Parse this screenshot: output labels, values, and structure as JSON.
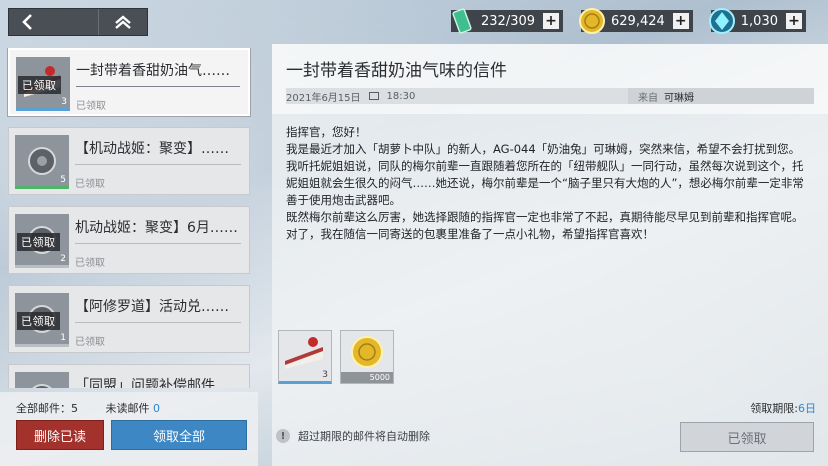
{
  "nav": {
    "back_icon": "chevron-left-icon",
    "home_icon": "chevron-up-icon"
  },
  "resources": [
    {
      "icon": "battery-icon",
      "value": "232/309"
    },
    {
      "icon": "gold-coin-icon",
      "value": "629,424"
    },
    {
      "icon": "gem-icon",
      "value": "1,030"
    }
  ],
  "mails": [
    {
      "title": "一封带着香甜奶油气……",
      "status": "已领取",
      "badge": "已领取",
      "count": "3",
      "selected": true,
      "thumb": "cake-icon"
    },
    {
      "title": "【机动战姬：聚变】……",
      "status": "已领取",
      "badge": "",
      "count": "5",
      "selected": false,
      "thumb": "part-icon"
    },
    {
      "title": "机动战姬：聚变】6月……",
      "status": "已领取",
      "badge": "已领取",
      "count": "2",
      "selected": false,
      "thumb": "part-icon"
    },
    {
      "title": "【阿修罗道】活动兑……",
      "status": "已领取",
      "badge": "已领取",
      "count": "1",
      "selected": false,
      "thumb": "part-icon"
    },
    {
      "title": "「同盟」问题补偿邮件",
      "status": "",
      "badge": "",
      "count": "",
      "selected": false,
      "thumb": "part-icon"
    }
  ],
  "footer_left": {
    "total_label": "全部邮件：",
    "total_value": "5",
    "unread_label": "未读邮件",
    "unread_value": "0",
    "delete_read": "删除已读",
    "claim_all": "领取全部"
  },
  "detail": {
    "title": "一封带着香甜奶油气味的信件",
    "date": "2021年6月15日",
    "time": "18:30",
    "from_label": "来自",
    "from": "可琳姆",
    "body": [
      "指挥官，您好！",
      "我是最近才加入「胡萝卜中队」的新人，AG-044「奶油兔」可琳姆，突然来信，希望不会打扰到您。",
      "我听托妮姐姐说，同队的梅尔前辈一直跟随着您所在的「纽带舰队」一同行动，虽然每次说到这个，托妮姐姐就会生很久的闷气……她还说，梅尔前辈是一个“脑子里只有大炮的人”，想必梅尔前辈一定非常善于使用炮击武器吧。",
      "既然梅尔前辈这么厉害，她选择跟随的指挥官一定也非常了不起，真期待能尽早见到前辈和指挥官呢。",
      "对了，我在随信一同寄送的包裹里准备了一点小礼物，希望指挥官喜欢！"
    ],
    "attachments": [
      {
        "icon": "cake-icon",
        "count": "3"
      },
      {
        "icon": "gold-coin-icon",
        "count": "5000"
      }
    ],
    "deadline_label": "领取期限:",
    "deadline_value": "6日",
    "warning": "超过期限的邮件将自动删除",
    "claim_button": "已领取"
  }
}
